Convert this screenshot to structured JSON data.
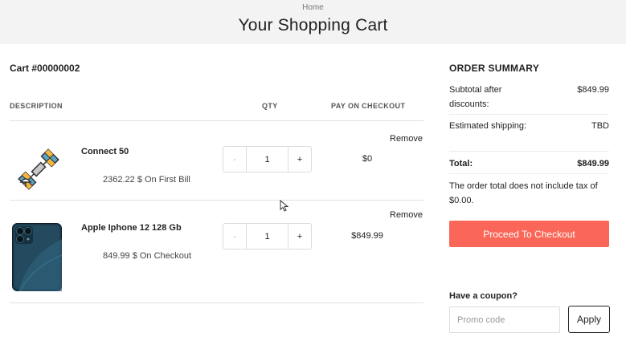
{
  "header": {
    "breadcrumb": "Home",
    "title": "Your Shopping Cart"
  },
  "cart": {
    "id_label": "Cart #00000002",
    "columns": {
      "description": "DESCRIPTION",
      "qty": "QTY",
      "pay_on_checkout": "PAY ON CHECKOUT"
    },
    "items": [
      {
        "name": "Connect 50",
        "price_note": "2362.22 $ On First Bill",
        "qty": "1",
        "minus": "-",
        "plus": "+",
        "pay_on_checkout": "$0",
        "remove_label": "Remove",
        "icon": "satellite-icon"
      },
      {
        "name": "Apple Iphone 12 128 Gb",
        "price_note": "849.99 $ On Checkout",
        "qty": "1",
        "minus": "-",
        "plus": "+",
        "pay_on_checkout": "$849.99",
        "remove_label": "Remove",
        "icon": "phone-image"
      }
    ]
  },
  "summary": {
    "title": "ORDER SUMMARY",
    "subtotal_label": "Subtotal after discounts:",
    "subtotal_value": "$849.99",
    "shipping_label": "Estimated shipping:",
    "shipping_value": "TBD",
    "total_label": "Total:",
    "total_value": "$849.99",
    "tax_note": "The order total does not include tax of $0.00.",
    "checkout_label": "Proceed To Checkout"
  },
  "coupon": {
    "label": "Have a coupon?",
    "placeholder": "Promo code",
    "apply_label": "Apply"
  },
  "colors": {
    "header_bg": "#f3f3f3",
    "checkout_button": "#fa6658"
  }
}
